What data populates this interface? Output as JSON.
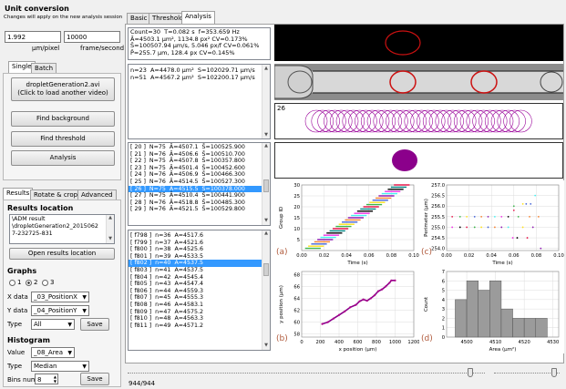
{
  "left": {
    "title": "Unit conversion",
    "subtitle": "Changes will apply on the new analysis session",
    "pixel_value": "1.992",
    "frame_value": "10000",
    "pixel_unit": "μm/pixel",
    "frame_unit": "frame/second",
    "tabs": [
      "Single",
      "Batch"
    ],
    "load_video_line1": "dropletGeneration2.avi",
    "load_video_line2": "(Click to load another video)",
    "find_background": "Find background",
    "find_threshold": "Find threshold",
    "analysis": "Analysis",
    "lower_tabs": [
      "Results",
      "Rotate & crop",
      "Advanced"
    ],
    "results_location_title": "Results location",
    "results_location_text": "\\ADM result\n\\dropletGeneration2_2015062\n7-232725-831",
    "open_results": "Open results location",
    "graphs_title": "Graphs",
    "radio_labels": [
      "1",
      "2",
      "3"
    ],
    "xdata_label": "X data",
    "xdata_value": "_03_PositionX",
    "ydata_label": "Y data",
    "ydata_value": "_04_PositionY",
    "type_label": "Type",
    "type_value": "All",
    "save": "Save",
    "histogram_title": "Histogram",
    "value_label": "Value",
    "value_value": "_08_Area",
    "htype_label": "Type",
    "htype_value": "Median",
    "bins_label": "Bins num",
    "bins_value": "8"
  },
  "main_tabs": [
    "Basic",
    "Threshold",
    "Analysis"
  ],
  "summary_lines": [
    "Count=30  T=0.082 s  f=353.659 Hz",
    "Ā=4503.1 μm², 1134.8 px² CV=0.173%",
    "S̄=100507.94 μm/s, 5.046 px/f CV=0.061%",
    "P̄=255.7 μm, 128.4 px CV=0.145%"
  ],
  "n_lines": [
    "n=23  A=4478.0 μm²  S=102029.71 μm/s",
    "n=51  A=4567.2 μm²  S=102200.17 μm/s"
  ],
  "group_rows": [
    "[ 20 ]  N=75  Ā=4507.1  S̄=100525.900",
    "[ 21 ]  N=76  Ā=4506.6  S̄=100510.700",
    "[ 22 ]  N=75  Ā=4507.8  S̄=100357.800",
    "[ 23 ]  N=75  Ā=4501.4  S̄=100452.600",
    "[ 24 ]  N=76  Ā=4506.9  S̄=100466.300",
    "[ 25 ]  N=76  Ā=4514.5  S̄=100527.300",
    "[ 26 ]  N=75  Ā=4515.5  S̄=100378.000",
    "[ 27 ]  N=75  Ā=4510.4  S̄=100441.900",
    "[ 28 ]  N=76  Ā=4518.8  S̄=100485.300",
    "[ 29 ]  N=76  Ā=4521.5  S̄=100529.800"
  ],
  "group_selected": 6,
  "frame_rows": [
    "[ f798 ]  n=36  A=4517.6",
    "[ f799 ]  n=37  A=4521.6",
    "[ f800 ]  n=38  A=4525.6",
    "[ f801 ]  n=39  A=4533.5",
    "[ f802 ]  n=40  A=4537.5",
    "[ f803 ]  n=41  A=4537.5",
    "[ f804 ]  n=42  A=4545.4",
    "[ f805 ]  n=43  A=4547.4",
    "[ f806 ]  n=44  A=4559.3",
    "[ f807 ]  n=45  A=4555.3",
    "[ f808 ]  n=46  A=4583.1",
    "[ f809 ]  n=47  A=4575.2",
    "[ f810 ]  n=48  A=4563.3",
    "[ f811 ]  n=49  A=4571.2"
  ],
  "frame_selected": 4,
  "overlay_label": "26",
  "status": "944/944",
  "colors": {
    "droplet_red": "#cc1111",
    "overlay_purple": "#990099",
    "fill_purple": "#8b008b",
    "selection": "#3399ff",
    "chart_label": "#b05a3c"
  },
  "chart_data": [
    {
      "type": "scatter",
      "panel_label": "(a)",
      "xlabel": "Time (s)",
      "ylabel": "Group ID",
      "xticks": [
        "0.00",
        "0.02",
        "0.04",
        "0.06",
        "0.08",
        "0.10"
      ],
      "yticks": [
        "5",
        "10",
        "15",
        "20",
        "25",
        "30"
      ],
      "xlim": [
        0,
        0.1
      ],
      "ylim": [
        0,
        30
      ],
      "series_note": "diagonal staircase of colored dashes, each group a short horizontal run",
      "groups": 30,
      "t_start": 0.003,
      "t_end": 0.085
    },
    {
      "type": "scatter",
      "panel_label": "(c)",
      "xlabel": "Time (s)",
      "ylabel": "Perimeter (μm)",
      "xticks": [
        "0.00",
        "0.02",
        "0.04",
        "0.06",
        "0.08",
        "0.10"
      ],
      "yticks": [
        "254.0",
        "254.5",
        "255.0",
        "255.5",
        "256.0",
        "256.5",
        "257.0"
      ],
      "xlim": [
        0,
        0.1
      ],
      "ylim": [
        253.9,
        257.0
      ],
      "points": [
        [
          0.005,
          255.5
        ],
        [
          0.012,
          255.5
        ],
        [
          0.018,
          255.5
        ],
        [
          0.025,
          255.5
        ],
        [
          0.031,
          255.5
        ],
        [
          0.037,
          255.5
        ],
        [
          0.043,
          255.5
        ],
        [
          0.049,
          255.5
        ],
        [
          0.055,
          255.5
        ],
        [
          0.06,
          255.8
        ],
        [
          0.064,
          255.5
        ],
        [
          0.068,
          255.0
        ],
        [
          0.071,
          256.1
        ],
        [
          0.074,
          255.5
        ],
        [
          0.077,
          255.0
        ],
        [
          0.079,
          256.5
        ],
        [
          0.005,
          255.0
        ],
        [
          0.012,
          255.0
        ],
        [
          0.018,
          255.0
        ],
        [
          0.025,
          255.0
        ],
        [
          0.031,
          255.0
        ],
        [
          0.037,
          255.0
        ],
        [
          0.043,
          255.0
        ],
        [
          0.049,
          255.0
        ],
        [
          0.055,
          255.0
        ],
        [
          0.059,
          254.5
        ],
        [
          0.063,
          254.5
        ],
        [
          0.072,
          254.5
        ],
        [
          0.06,
          256.0
        ],
        [
          0.068,
          256.1
        ],
        [
          0.075,
          256.1
        ],
        [
          0.082,
          255.5
        ],
        [
          0.084,
          254.0
        ]
      ]
    },
    {
      "type": "line",
      "panel_label": "(b)",
      "xlabel": "x position (μm)",
      "ylabel": "y position (μm)",
      "xticks": [
        "0",
        "200",
        "400",
        "600",
        "800",
        "1000",
        "1200"
      ],
      "yticks": [
        "58",
        "60",
        "62",
        "64",
        "66",
        "68"
      ],
      "xlim": [
        0,
        1200
      ],
      "ylim": [
        57.5,
        68.5
      ],
      "points": [
        [
          220,
          59.7
        ],
        [
          280,
          60.0
        ],
        [
          340,
          60.6
        ],
        [
          400,
          61.2
        ],
        [
          460,
          61.8
        ],
        [
          520,
          62.5
        ],
        [
          580,
          62.9
        ],
        [
          620,
          63.5
        ],
        [
          660,
          63.8
        ],
        [
          700,
          63.6
        ],
        [
          740,
          64.0
        ],
        [
          780,
          64.5
        ],
        [
          820,
          65.2
        ],
        [
          860,
          65.5
        ],
        [
          900,
          66.0
        ],
        [
          940,
          66.6
        ],
        [
          960,
          67.0
        ],
        [
          1000,
          67.0
        ]
      ]
    },
    {
      "type": "bar",
      "panel_label": "(d)",
      "xlabel": "Area (μm²)",
      "ylabel": "Count",
      "xticks": [
        "4500",
        "4510",
        "4520",
        "4530"
      ],
      "yticks": [
        "0",
        "1",
        "2",
        "3",
        "4",
        "5",
        "6",
        "7"
      ],
      "xlim": [
        4493,
        4532
      ],
      "ylim": [
        0,
        7
      ],
      "bin_edges": [
        4496,
        4500,
        4504,
        4508,
        4512,
        4516,
        4520,
        4524,
        4528
      ],
      "values": [
        4,
        6,
        5,
        6,
        3,
        2,
        2,
        2
      ]
    }
  ]
}
